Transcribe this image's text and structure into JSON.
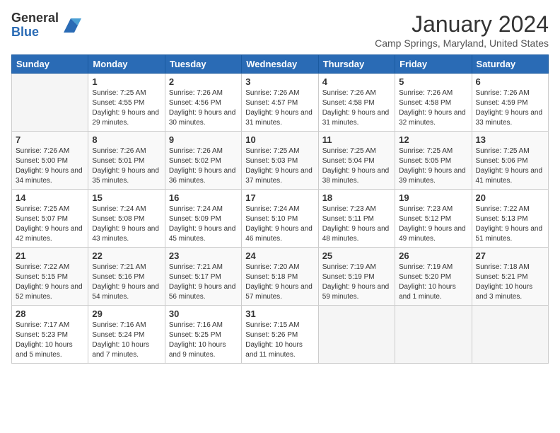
{
  "header": {
    "logo_general": "General",
    "logo_blue": "Blue",
    "month_title": "January 2024",
    "location": "Camp Springs, Maryland, United States"
  },
  "days_of_week": [
    "Sunday",
    "Monday",
    "Tuesday",
    "Wednesday",
    "Thursday",
    "Friday",
    "Saturday"
  ],
  "weeks": [
    [
      {
        "day": "",
        "sunrise": "",
        "sunset": "",
        "daylight": ""
      },
      {
        "day": "1",
        "sunrise": "Sunrise: 7:25 AM",
        "sunset": "Sunset: 4:55 PM",
        "daylight": "Daylight: 9 hours and 29 minutes."
      },
      {
        "day": "2",
        "sunrise": "Sunrise: 7:26 AM",
        "sunset": "Sunset: 4:56 PM",
        "daylight": "Daylight: 9 hours and 30 minutes."
      },
      {
        "day": "3",
        "sunrise": "Sunrise: 7:26 AM",
        "sunset": "Sunset: 4:57 PM",
        "daylight": "Daylight: 9 hours and 31 minutes."
      },
      {
        "day": "4",
        "sunrise": "Sunrise: 7:26 AM",
        "sunset": "Sunset: 4:58 PM",
        "daylight": "Daylight: 9 hours and 31 minutes."
      },
      {
        "day": "5",
        "sunrise": "Sunrise: 7:26 AM",
        "sunset": "Sunset: 4:58 PM",
        "daylight": "Daylight: 9 hours and 32 minutes."
      },
      {
        "day": "6",
        "sunrise": "Sunrise: 7:26 AM",
        "sunset": "Sunset: 4:59 PM",
        "daylight": "Daylight: 9 hours and 33 minutes."
      }
    ],
    [
      {
        "day": "7",
        "sunrise": "Sunrise: 7:26 AM",
        "sunset": "Sunset: 5:00 PM",
        "daylight": "Daylight: 9 hours and 34 minutes."
      },
      {
        "day": "8",
        "sunrise": "Sunrise: 7:26 AM",
        "sunset": "Sunset: 5:01 PM",
        "daylight": "Daylight: 9 hours and 35 minutes."
      },
      {
        "day": "9",
        "sunrise": "Sunrise: 7:26 AM",
        "sunset": "Sunset: 5:02 PM",
        "daylight": "Daylight: 9 hours and 36 minutes."
      },
      {
        "day": "10",
        "sunrise": "Sunrise: 7:25 AM",
        "sunset": "Sunset: 5:03 PM",
        "daylight": "Daylight: 9 hours and 37 minutes."
      },
      {
        "day": "11",
        "sunrise": "Sunrise: 7:25 AM",
        "sunset": "Sunset: 5:04 PM",
        "daylight": "Daylight: 9 hours and 38 minutes."
      },
      {
        "day": "12",
        "sunrise": "Sunrise: 7:25 AM",
        "sunset": "Sunset: 5:05 PM",
        "daylight": "Daylight: 9 hours and 39 minutes."
      },
      {
        "day": "13",
        "sunrise": "Sunrise: 7:25 AM",
        "sunset": "Sunset: 5:06 PM",
        "daylight": "Daylight: 9 hours and 41 minutes."
      }
    ],
    [
      {
        "day": "14",
        "sunrise": "Sunrise: 7:25 AM",
        "sunset": "Sunset: 5:07 PM",
        "daylight": "Daylight: 9 hours and 42 minutes."
      },
      {
        "day": "15",
        "sunrise": "Sunrise: 7:24 AM",
        "sunset": "Sunset: 5:08 PM",
        "daylight": "Daylight: 9 hours and 43 minutes."
      },
      {
        "day": "16",
        "sunrise": "Sunrise: 7:24 AM",
        "sunset": "Sunset: 5:09 PM",
        "daylight": "Daylight: 9 hours and 45 minutes."
      },
      {
        "day": "17",
        "sunrise": "Sunrise: 7:24 AM",
        "sunset": "Sunset: 5:10 PM",
        "daylight": "Daylight: 9 hours and 46 minutes."
      },
      {
        "day": "18",
        "sunrise": "Sunrise: 7:23 AM",
        "sunset": "Sunset: 5:11 PM",
        "daylight": "Daylight: 9 hours and 48 minutes."
      },
      {
        "day": "19",
        "sunrise": "Sunrise: 7:23 AM",
        "sunset": "Sunset: 5:12 PM",
        "daylight": "Daylight: 9 hours and 49 minutes."
      },
      {
        "day": "20",
        "sunrise": "Sunrise: 7:22 AM",
        "sunset": "Sunset: 5:13 PM",
        "daylight": "Daylight: 9 hours and 51 minutes."
      }
    ],
    [
      {
        "day": "21",
        "sunrise": "Sunrise: 7:22 AM",
        "sunset": "Sunset: 5:15 PM",
        "daylight": "Daylight: 9 hours and 52 minutes."
      },
      {
        "day": "22",
        "sunrise": "Sunrise: 7:21 AM",
        "sunset": "Sunset: 5:16 PM",
        "daylight": "Daylight: 9 hours and 54 minutes."
      },
      {
        "day": "23",
        "sunrise": "Sunrise: 7:21 AM",
        "sunset": "Sunset: 5:17 PM",
        "daylight": "Daylight: 9 hours and 56 minutes."
      },
      {
        "day": "24",
        "sunrise": "Sunrise: 7:20 AM",
        "sunset": "Sunset: 5:18 PM",
        "daylight": "Daylight: 9 hours and 57 minutes."
      },
      {
        "day": "25",
        "sunrise": "Sunrise: 7:19 AM",
        "sunset": "Sunset: 5:19 PM",
        "daylight": "Daylight: 9 hours and 59 minutes."
      },
      {
        "day": "26",
        "sunrise": "Sunrise: 7:19 AM",
        "sunset": "Sunset: 5:20 PM",
        "daylight": "Daylight: 10 hours and 1 minute."
      },
      {
        "day": "27",
        "sunrise": "Sunrise: 7:18 AM",
        "sunset": "Sunset: 5:21 PM",
        "daylight": "Daylight: 10 hours and 3 minutes."
      }
    ],
    [
      {
        "day": "28",
        "sunrise": "Sunrise: 7:17 AM",
        "sunset": "Sunset: 5:23 PM",
        "daylight": "Daylight: 10 hours and 5 minutes."
      },
      {
        "day": "29",
        "sunrise": "Sunrise: 7:16 AM",
        "sunset": "Sunset: 5:24 PM",
        "daylight": "Daylight: 10 hours and 7 minutes."
      },
      {
        "day": "30",
        "sunrise": "Sunrise: 7:16 AM",
        "sunset": "Sunset: 5:25 PM",
        "daylight": "Daylight: 10 hours and 9 minutes."
      },
      {
        "day": "31",
        "sunrise": "Sunrise: 7:15 AM",
        "sunset": "Sunset: 5:26 PM",
        "daylight": "Daylight: 10 hours and 11 minutes."
      },
      {
        "day": "",
        "sunrise": "",
        "sunset": "",
        "daylight": ""
      },
      {
        "day": "",
        "sunrise": "",
        "sunset": "",
        "daylight": ""
      },
      {
        "day": "",
        "sunrise": "",
        "sunset": "",
        "daylight": ""
      }
    ]
  ]
}
